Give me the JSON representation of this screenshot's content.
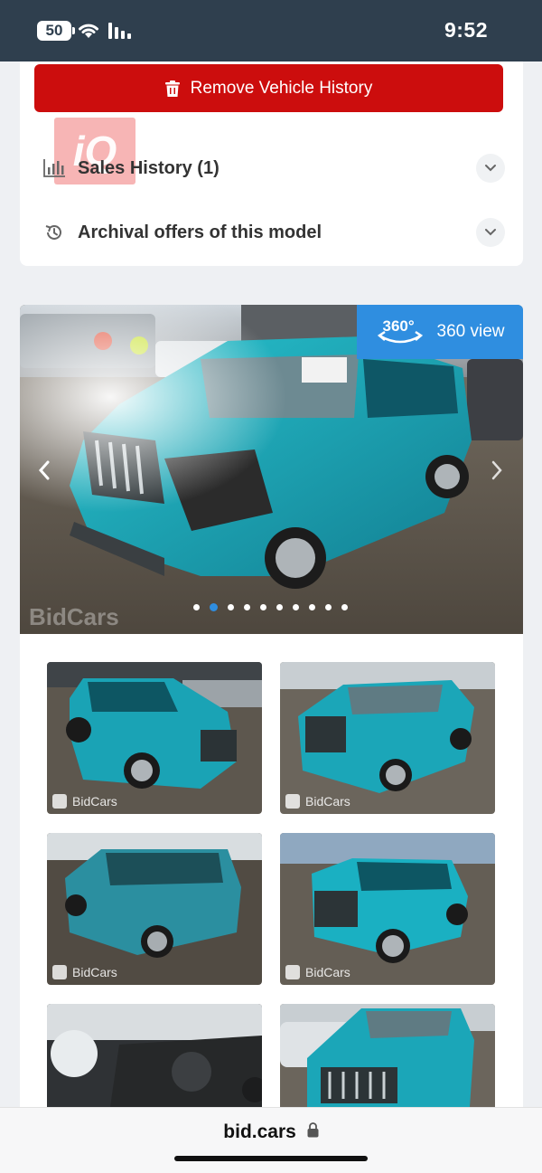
{
  "status_bar": {
    "battery": "50",
    "time": "9:52"
  },
  "actions": {
    "remove_history_label": "Remove Vehicle History"
  },
  "sections": {
    "sales_history_label": "Sales History (1)",
    "archival_offers_label": "Archival offers of this model"
  },
  "logo_text": "iQ",
  "gallery": {
    "view360_degrees": "360°",
    "view360_label": "360 view",
    "watermark": "BidCars",
    "dot_count": 10,
    "active_dot": 1,
    "thumbnails": [
      {
        "watermark": "BidCars"
      },
      {
        "watermark": "BidCars"
      },
      {
        "watermark": "BidCars"
      },
      {
        "watermark": "BidCars"
      },
      {
        "watermark": ""
      },
      {
        "watermark": ""
      }
    ]
  },
  "browser": {
    "url": "bid.cars"
  },
  "colors": {
    "remove_button": "#cc0d0d",
    "view360_badge": "#2f8ee0",
    "status_bar": "#2f3f4e",
    "vehicle": "#1aa3b5"
  },
  "icons": [
    "battery-icon",
    "wifi-icon",
    "signal-icon",
    "trash-icon",
    "bar-chart-icon",
    "history-icon",
    "chevron-down-icon",
    "rotate-360-icon",
    "chevron-left-icon",
    "chevron-right-icon",
    "lock-icon"
  ]
}
